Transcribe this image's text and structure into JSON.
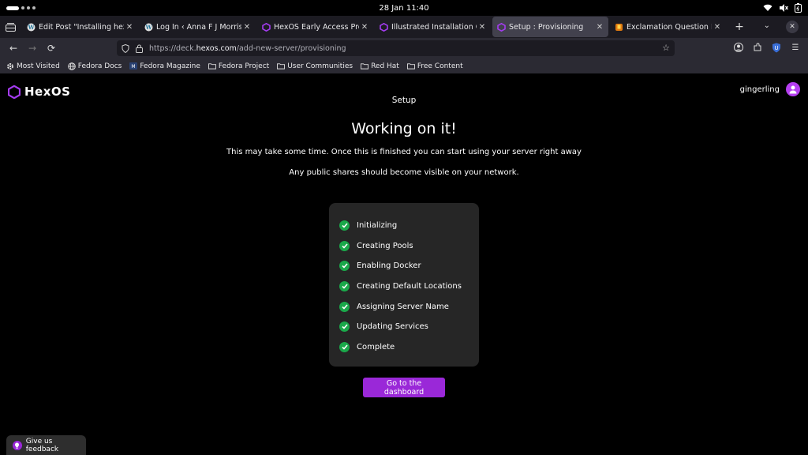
{
  "system": {
    "date_time": "28 Jan  11:40"
  },
  "tabs": [
    {
      "title": "Edit Post \"Installing hexos",
      "icon": "wordpress-icon",
      "active": false
    },
    {
      "title": "Log In ‹ Anna F J Morris — WordPress",
      "icon": "wordpress-icon",
      "active": false
    },
    {
      "title": "HexOS Early Access Program",
      "icon": "hexos-icon",
      "active": false
    },
    {
      "title": "Illustrated Installation Guide",
      "icon": "hexos-icon",
      "active": false
    },
    {
      "title": "Setup : Provisioning",
      "icon": "hexos-icon",
      "active": true
    },
    {
      "title": "Exclamation Question Mark",
      "icon": "emoji-icon",
      "active": false
    }
  ],
  "address": {
    "scheme": "https://deck.",
    "host": "hexos.com",
    "path": "/add-new-server/provisioning"
  },
  "bookmarks": [
    {
      "label": "Most Visited",
      "icon": "gear-icon"
    },
    {
      "label": "Fedora Docs",
      "icon": "globe-icon"
    },
    {
      "label": "Fedora Magazine",
      "icon": "fedora-icon"
    },
    {
      "label": "Fedora Project",
      "icon": "folder-icon"
    },
    {
      "label": "User Communities",
      "icon": "folder-icon"
    },
    {
      "label": "Red Hat",
      "icon": "folder-icon"
    },
    {
      "label": "Free Content",
      "icon": "folder-icon"
    }
  ],
  "app": {
    "logo_text": "HexOS",
    "username": "gingerling",
    "section": "Setup",
    "heading": "Working on it!",
    "line1": "This may take some time. Once this is finished you can start using your server right away",
    "line2": "Any public shares should become visible on your network.",
    "steps": [
      {
        "label": "Initializing",
        "done": true
      },
      {
        "label": "Creating Pools",
        "done": true
      },
      {
        "label": "Enabling Docker",
        "done": true
      },
      {
        "label": "Creating Default Locations",
        "done": true
      },
      {
        "label": "Assigning Server Name",
        "done": true
      },
      {
        "label": "Updating Services",
        "done": true
      },
      {
        "label": "Complete",
        "done": true
      }
    ],
    "cta_label": "Go to the dashboard",
    "feedback_label": "Give us feedback"
  },
  "colors": {
    "accent": "#9a28d8",
    "check": "#1aa84a",
    "card": "#262626"
  }
}
